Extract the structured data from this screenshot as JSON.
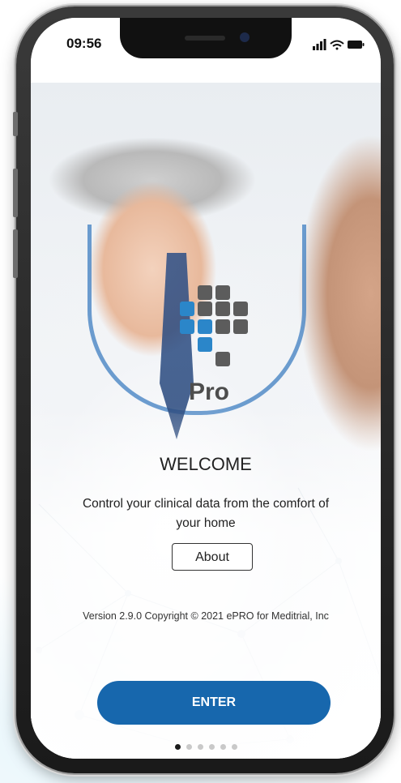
{
  "status_bar": {
    "time": "09:56"
  },
  "welcome": {
    "title": "WELCOME",
    "tagline": "Control your clinical data from the comfort of your home",
    "about_label": "About",
    "version_text": "Version 2.9.0 Copyright © 2021 ePRO for Meditrial, Inc",
    "enter_label": "ENTER"
  },
  "logo": {
    "text": "Pro"
  },
  "pager": {
    "count": 6,
    "active_index": 0
  },
  "colors": {
    "accent": "#1767ad",
    "logo_blue": "#2b86c9",
    "logo_gray": "#5c5c5c"
  }
}
